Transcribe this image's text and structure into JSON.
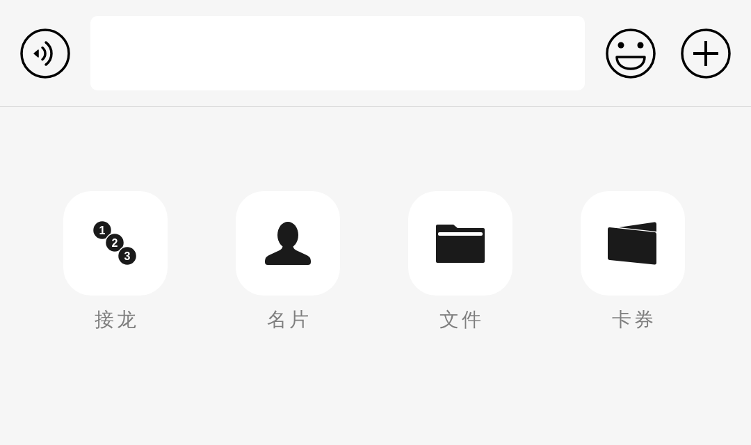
{
  "panel_items": [
    {
      "kind": "sequence",
      "label": "接龙",
      "numbers": [
        "1",
        "2",
        "3"
      ]
    },
    {
      "kind": "contact",
      "label": "名片"
    },
    {
      "kind": "file",
      "label": "文件"
    },
    {
      "kind": "card",
      "label": "卡券"
    }
  ]
}
